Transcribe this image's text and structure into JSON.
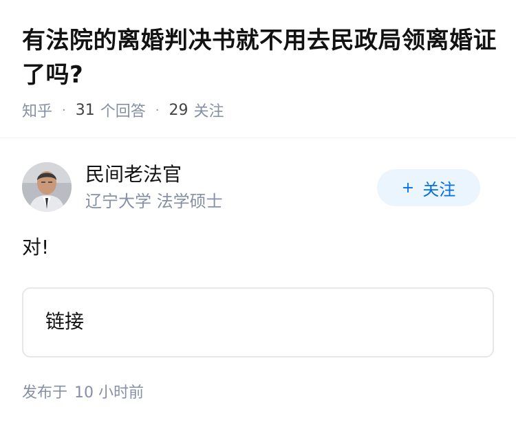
{
  "question": {
    "title": "有法院的离婚判决书就不用去民政局领离婚证了吗?",
    "source": "知乎",
    "answer_count": "31",
    "answer_label": "个回答",
    "follow_count": "29",
    "follow_label": "关注"
  },
  "answer": {
    "author": {
      "name": "民间老法官",
      "headline": "辽宁大学 法学硕士",
      "avatar_icon": "avatar-photo"
    },
    "follow_button": {
      "icon": "+",
      "label": "关注"
    },
    "content": "对!",
    "link_card": {
      "label": "链接"
    },
    "publish": {
      "prefix": "发布于",
      "time": "10 小时前"
    }
  },
  "colors": {
    "meta_gray": "#8590a6",
    "accent_blue": "#056de8",
    "follow_bg": "#ebf5fd",
    "text": "#121212"
  }
}
